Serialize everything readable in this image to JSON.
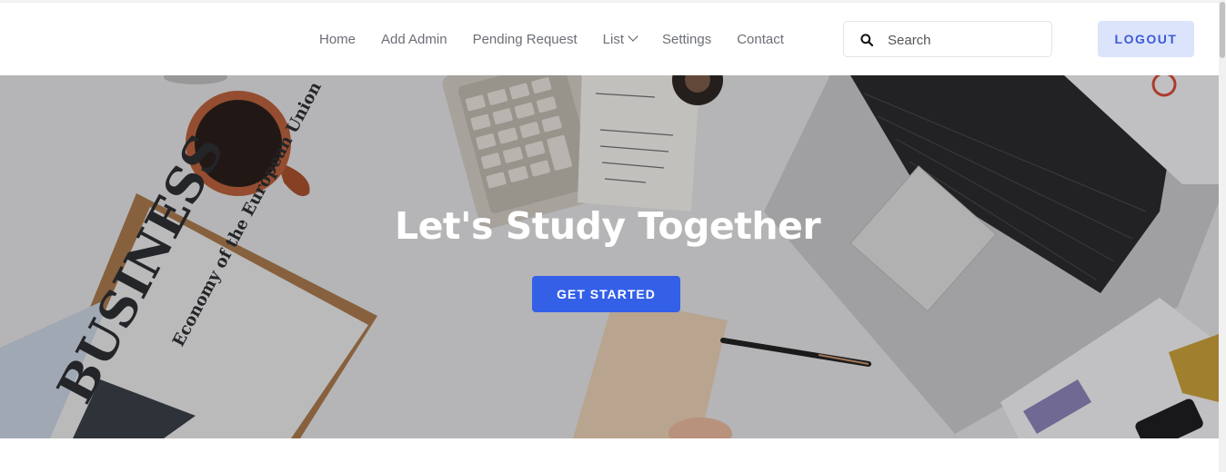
{
  "nav": {
    "items": [
      {
        "label": "Home"
      },
      {
        "label": "Add Admin"
      },
      {
        "label": "Pending Request"
      },
      {
        "label": "List",
        "has_dropdown": true
      },
      {
        "label": "Settings"
      },
      {
        "label": "Contact"
      }
    ]
  },
  "search": {
    "placeholder": "Search",
    "icon": "search-icon"
  },
  "logout": {
    "label": "LOGOUT"
  },
  "hero": {
    "title": "Let's Study Together",
    "cta_label": "GET STARTED",
    "newspaper_text": "BUSINESS",
    "headline_text": "Economy of the European Union"
  },
  "colors": {
    "accent": "#3460e8",
    "logout_bg": "#dce4fb",
    "logout_text": "#3b5bd6",
    "nav_text": "#6b6f75"
  }
}
